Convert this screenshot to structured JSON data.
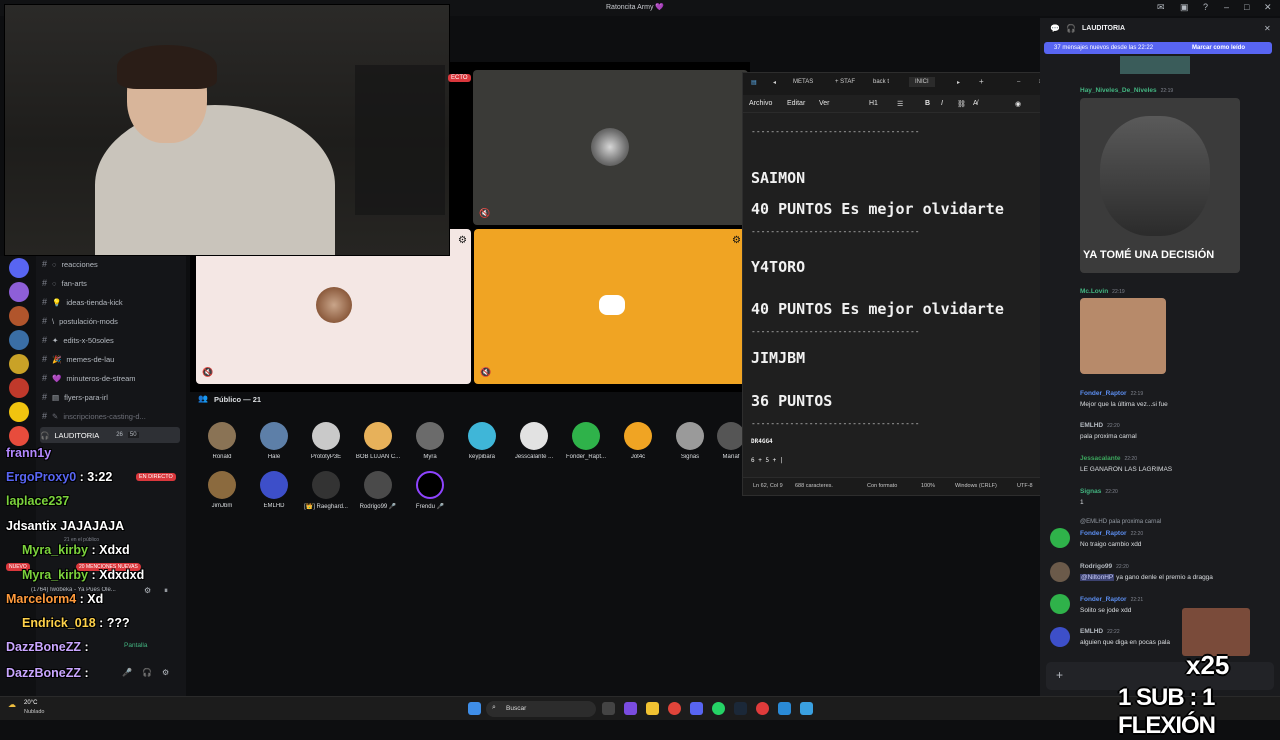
{
  "app": {
    "title": "Ratoncita Army 💜",
    "live_badge": "ECTO"
  },
  "channels": [
    {
      "name": "reacciones",
      "icon": "◌"
    },
    {
      "name": "fan-arts",
      "icon": "◌"
    },
    {
      "name": "ideas-tienda-kick",
      "icon": "💡"
    },
    {
      "name": "postulación-mods",
      "icon": "\\"
    },
    {
      "name": "edits-x-50soles",
      "icon": "✦"
    },
    {
      "name": "memes-de-lau",
      "icon": "🎉"
    },
    {
      "name": "minuteros-de-stream",
      "icon": "💜"
    },
    {
      "name": "flyers-para-irl",
      "icon": "▤"
    },
    {
      "name": "inscripciones-casting-d...",
      "icon": "✎"
    }
  ],
  "voice": {
    "channel": "LAUDITORIA",
    "count_a": "26",
    "count_b": "50",
    "live_tag": "EN DIRECTO",
    "sub": "21 en el público",
    "mentions": "20 MENCIONES NUEVAS",
    "new_tag": "NUEVO",
    "status_line": "(1764) Iwobeka - Ya Pues Ole...",
    "screen_label": "Pantalla"
  },
  "audience": {
    "header": "Público — 21",
    "row1": [
      "Ronald",
      "Hale",
      "PrototyP3E",
      "BOB LUJAN C...",
      "Myra",
      "keypibara",
      "Jesscalante ...",
      "Fonder_Rapt...",
      "Jot4c",
      "Signas",
      "Maríaf"
    ],
    "row2": [
      "JimJbm",
      "EMLHD",
      "[👑] Raeghard...",
      "Rodrigo99 🎤",
      "Frendu 🎤"
    ]
  },
  "notepad": {
    "tabs": [
      "METAS",
      "+ STAF",
      "back t",
      "INICI"
    ],
    "menu": [
      "Archivo",
      "Editar",
      "Ver"
    ],
    "heading_sel": "H1",
    "lines": {
      "sep": "-----------------------------------",
      "name1": "SAIMON",
      "pts1": "40 PUNTOS Es mejor olvidarte",
      "name2": "Y4TORO",
      "pts2": "40 PUNTOS Es mejor olvidarte",
      "name3": "JIMJBM",
      "pts3": "36 PUNTOS",
      "name4": "DR4GG4",
      "pts4": "6 + 5 + |"
    },
    "status": [
      "Ln 62, Col 9",
      "688 caracteres.",
      "Con formato",
      "100%",
      "Windows (CRLF)",
      "UTF-8"
    ]
  },
  "chat": {
    "channel": "LAUDITORIA",
    "new_messages": "37 mensajes nuevos desde las 22:22",
    "mark_read": "Marcar como leído",
    "messages": [
      {
        "user": "Hay_Niveles_De_Niveles",
        "time": "22:19",
        "color": "#43b581",
        "text": ""
      },
      {
        "user": "",
        "time": "",
        "color": "#ffffff",
        "text": "YA TOMÉ UNA DECISIÓN"
      },
      {
        "user": "Mc.Lovin",
        "time": "22:19",
        "color": "#43b581",
        "text": ""
      },
      {
        "user": "Fonder_Raptor",
        "time": "22:19",
        "color": "#5b8def",
        "text": "Mejor que la última vez...si fue"
      },
      {
        "user": "EMLHD",
        "time": "22:20",
        "color": "#b5bac1",
        "text": "pala proxima carnal"
      },
      {
        "user": "Jessacalante",
        "time": "22:20",
        "color": "#3ba55c",
        "text": "LE GANARON LAS LAGRIMAS"
      },
      {
        "user": "Signas",
        "time": "22:20",
        "color": "#43b581",
        "text": "1"
      },
      {
        "user": "@EMLHD",
        "time": "",
        "color": "#b5bac1",
        "text": "pala proxima carnal"
      },
      {
        "user": "Fonder_Raptor",
        "time": "22:20",
        "color": "#5b8def",
        "text": "No traigo cambio xdd"
      },
      {
        "user": "Rodrigo99",
        "time": "22:20",
        "color": "#b5bac1",
        "text": "ya gano denle el premio a dragga"
      },
      {
        "user": "Fonder_Raptor",
        "time": "22:21",
        "color": "#5b8def",
        "text": "Solito se jode xdd"
      },
      {
        "user": "EMLHD",
        "time": "22:22",
        "color": "#b5bac1",
        "text": "alguien que diga en pocas pala"
      }
    ],
    "mention": "@NiltonHP"
  },
  "overlay_chat": [
    {
      "user": "frann1y",
      "msg": "",
      "color": "#b388ff"
    },
    {
      "user": "ErgoProxy0",
      "msg": " : 3:22",
      "color": "#5865f2"
    },
    {
      "user": "laplace237",
      "msg": "",
      "color": "#7bd23c"
    },
    {
      "user": "Jdsantix",
      "msg": " JAJAJAJA",
      "color": "#ffffff"
    },
    {
      "user": "Myra_kirby",
      "msg": " : Xdxd",
      "color": "#7bd23c"
    },
    {
      "user": "Myra_kirby",
      "msg": " : Xdxdxd",
      "color": "#7bd23c"
    },
    {
      "user": "Marcelorm4",
      "msg": " : Xd",
      "color": "#ff9a3c"
    },
    {
      "user": "Endrick_018",
      "msg": " : ???",
      "color": "#ffd24a"
    },
    {
      "user": "DazzBoneZZ",
      "msg": " :",
      "color": "#c9a6ff"
    },
    {
      "user": "DazzBoneZZ",
      "msg": " :",
      "color": "#c9a6ff"
    }
  ],
  "promo": {
    "multiplier": "x25",
    "text": "1 SUB : 1 FLEXIÓN"
  },
  "taskbar": {
    "weather_temp": "20°C",
    "weather_desc": "Nublado",
    "search": "Buscar"
  }
}
